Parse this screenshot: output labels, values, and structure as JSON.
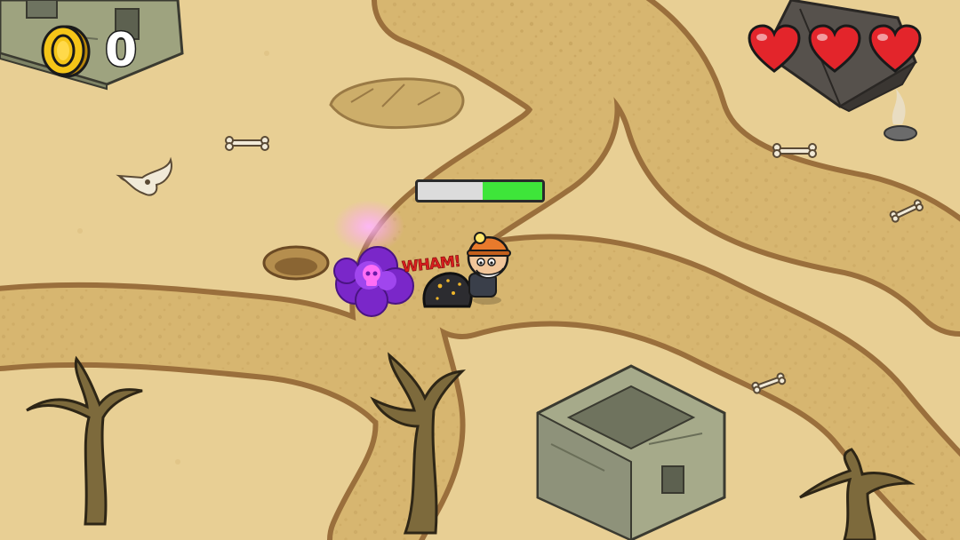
{
  "hud": {
    "coins": "0",
    "hearts": {
      "filled": 3,
      "total": 3
    },
    "player_health": 0.48
  },
  "effects": {
    "hit_text": "WHAM!"
  },
  "icons": {
    "coin": "coin-icon",
    "heart": "heart-icon",
    "skull": "skull-icon"
  },
  "colors": {
    "sand": "#e8cf94",
    "path": "#d7b670",
    "path_border": "#9a6f3c",
    "heart_red": "#e3252b",
    "coin_gold": "#f5c518",
    "health_green": "#3ee53a",
    "poison_purple": "#8a2bd6"
  }
}
